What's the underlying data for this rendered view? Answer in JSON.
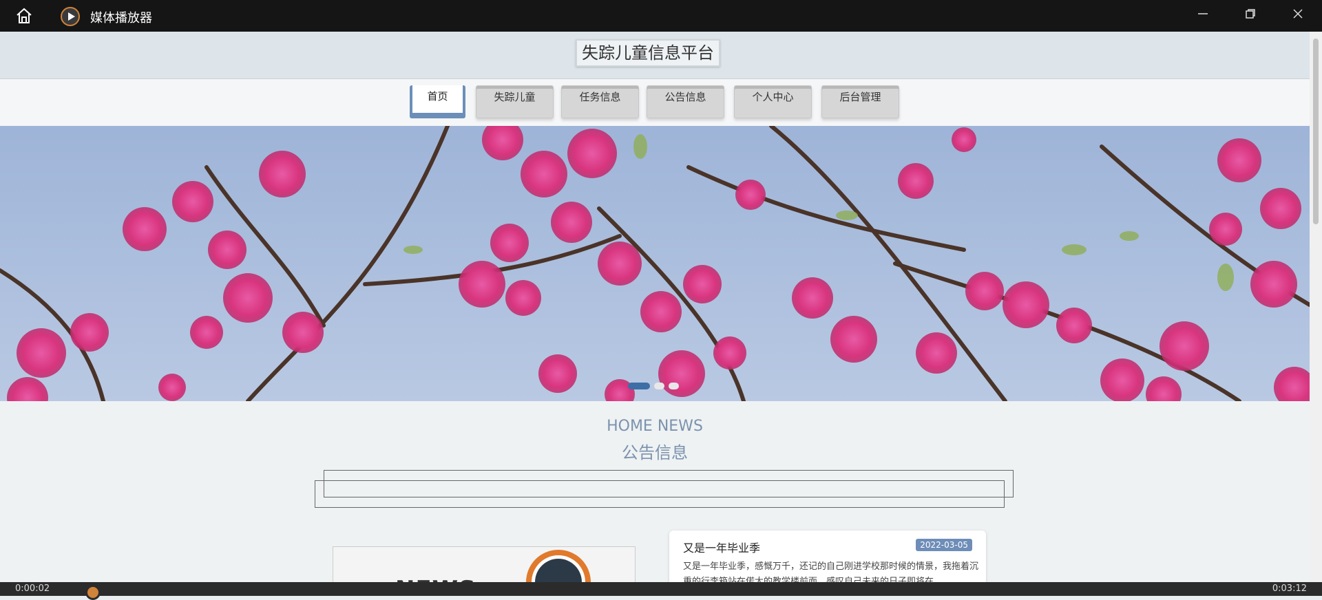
{
  "window": {
    "app_title": "媒体播放器"
  },
  "site": {
    "title": "失踪儿童信息平台"
  },
  "nav": {
    "items": [
      {
        "label": "首页",
        "active": true
      },
      {
        "label": "失踪儿童",
        "active": false
      },
      {
        "label": "任务信息",
        "active": false
      },
      {
        "label": "公告信息",
        "active": false
      },
      {
        "label": "个人中心",
        "active": false
      },
      {
        "label": "后台管理",
        "active": false
      }
    ]
  },
  "banner": {
    "slide_count": 3,
    "active_slide": 1
  },
  "news_section": {
    "title_en": "HOME NEWS",
    "title_cn": "公告信息",
    "featured_image_text": "NEWS",
    "first_item": {
      "title": "又是一年毕业季",
      "date": "2022-03-05",
      "excerpt": "又是一年毕业季，感慨万千，还记的自己刚进学校那时候的情景，我拖着沉重的行李箱站在偌大的教学楼前面，感叹自己未来的日子即将在"
    }
  },
  "player": {
    "current_time": "0:00:02",
    "total_time": "0:03:12",
    "progress": 0.01
  },
  "colors": {
    "accent": "#6b8fb8",
    "section_title": "#7c92ad",
    "date_badge": "#6e8db8"
  }
}
